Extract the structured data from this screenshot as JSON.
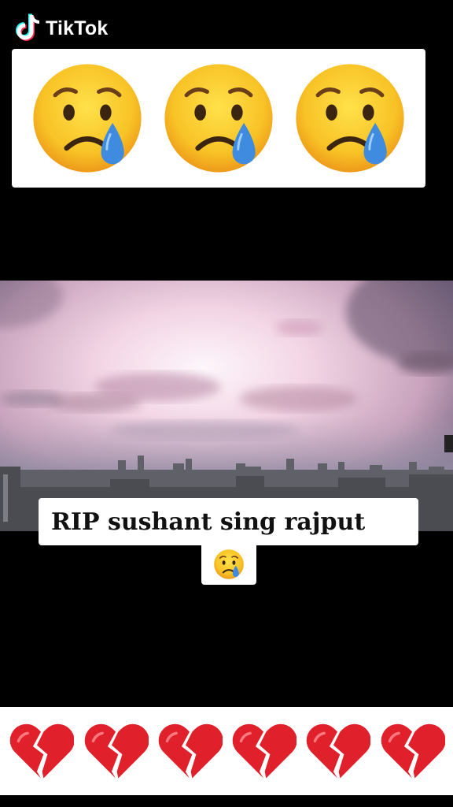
{
  "watermark": {
    "brand": "TikTok",
    "icon": "tiktok-note-icon"
  },
  "top_card": {
    "emoji": "crying-face",
    "count": 3
  },
  "video": {
    "scene": "pink-sky-city-skyline"
  },
  "caption": {
    "text": "RIP sushant sing rajput",
    "emoji": "crying-face"
  },
  "bottom_card": {
    "emoji": "broken-heart",
    "count": 6
  },
  "colors": {
    "background": "#000000",
    "card": "#ffffff",
    "emoji_face": "#f8c326",
    "emoji_tear": "#3f8be0",
    "heart_red": "#e0212b"
  }
}
